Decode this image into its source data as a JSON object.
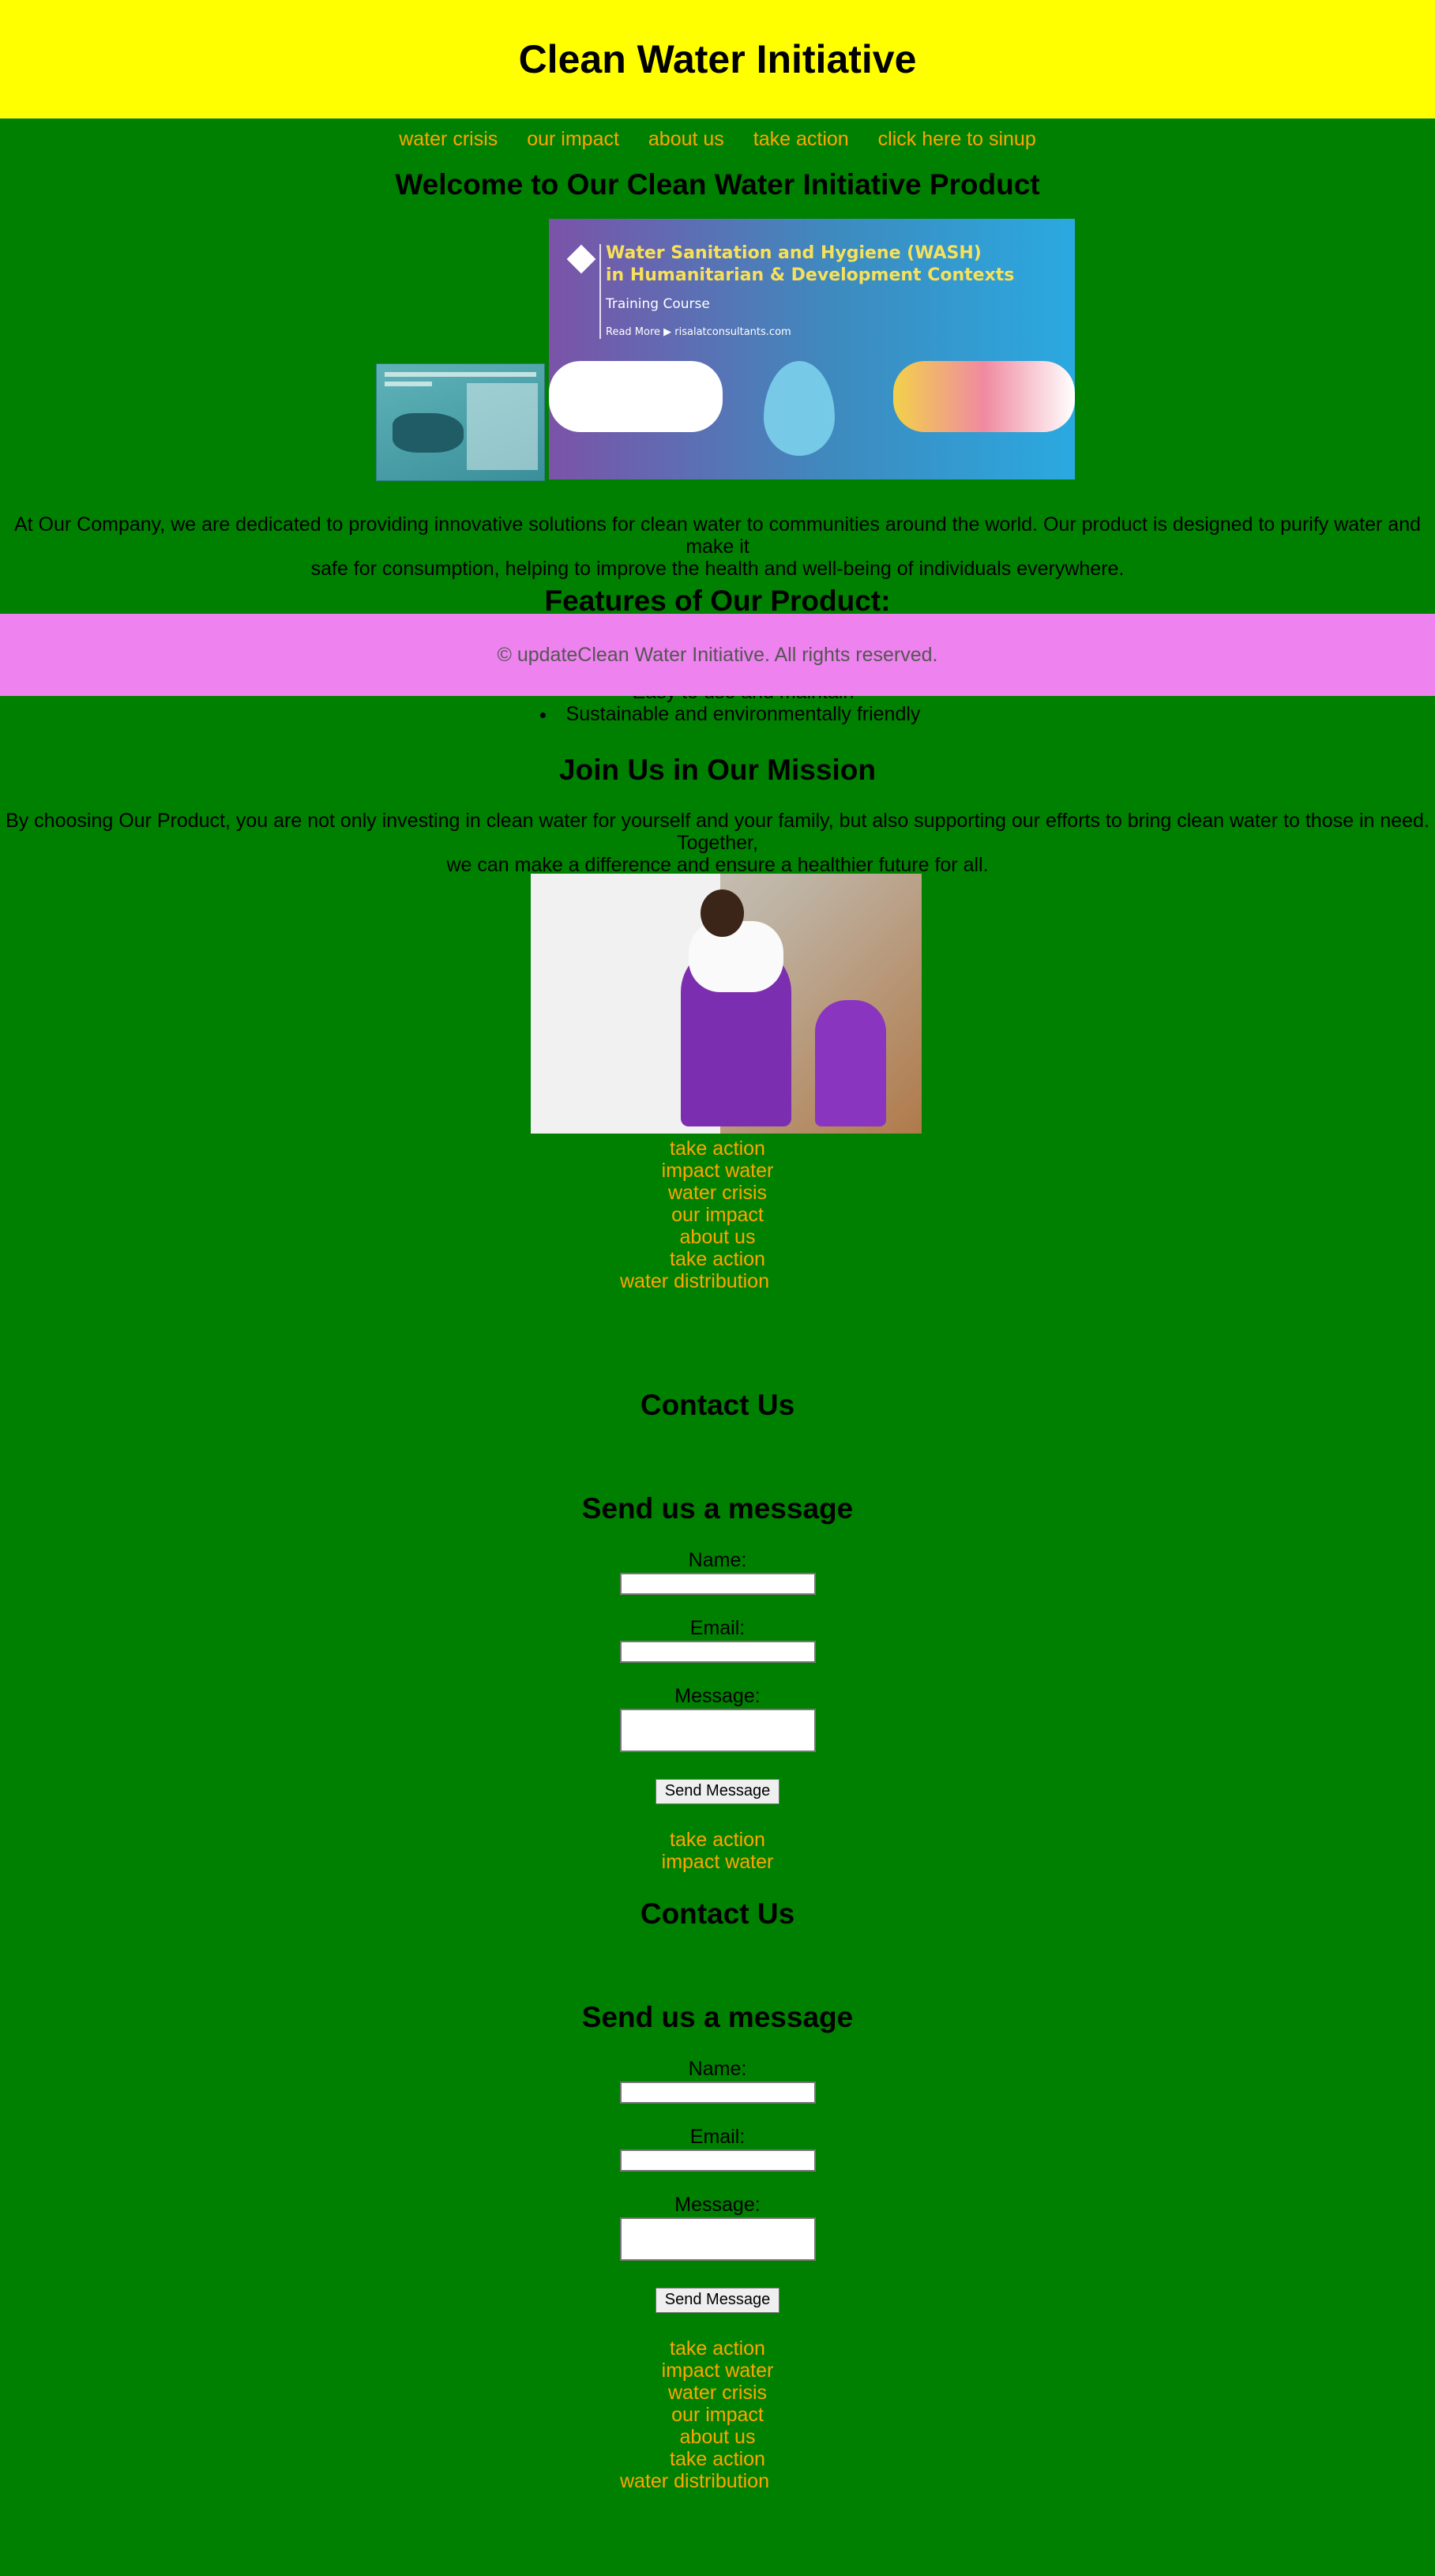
{
  "header": {
    "title": "Clean Water Initiative"
  },
  "nav": [
    "water crisis",
    "our impact",
    "about us",
    "take action",
    "click here to sinup"
  ],
  "welcome": {
    "title": "Welcome to Our Clean Water Initiative Product",
    "banner": {
      "line1": "Water Sanitation and Hygiene (WASH)",
      "line2": "in Humanitarian & Development Contexts",
      "line3": "Training Course",
      "line4": "Read More ▶ risalatconsultants.com"
    },
    "paragraph_line1": "At Our Company, we are dedicated to providing innovative solutions for clean water to communities around the world. Our product is designed to purify water and make it",
    "paragraph_line2": "safe for consumption, helping to improve the health and well-being of individuals everywhere."
  },
  "features": {
    "title": "Features of Our Product:",
    "items": [
      "Easy to use and maintain",
      "Sustainable and environmentally friendly"
    ]
  },
  "footer": {
    "text": "© updateClean Water Initiative. All rights reserved."
  },
  "mission": {
    "title": "Join Us in Our Mission",
    "line1": "By choosing Our Product, you are not only investing in clean water for yourself and your family, but also supporting our efforts to bring clean water to those in need. Together,",
    "line2": "we can make a difference and ensure a healthier future for all."
  },
  "links1": [
    "take action",
    "impact water",
    "water crisis",
    "our impact",
    "about us",
    "take action",
    "water distribution"
  ],
  "contact1": {
    "title": "Contact Us",
    "form_title": "Send us a message",
    "name_label": "Name:",
    "email_label": "Email:",
    "message_label": "Message:",
    "button": "Send Message"
  },
  "links2": [
    "take action",
    "impact water"
  ],
  "contact2": {
    "title": "Contact Us",
    "form_title": "Send us a message",
    "name_label": "Name:",
    "email_label": "Email:",
    "message_label": "Message:",
    "button": "Send Message"
  },
  "links3": [
    "take action",
    "impact water",
    "water crisis",
    "our impact",
    "about us",
    "take action",
    "water distribution"
  ]
}
